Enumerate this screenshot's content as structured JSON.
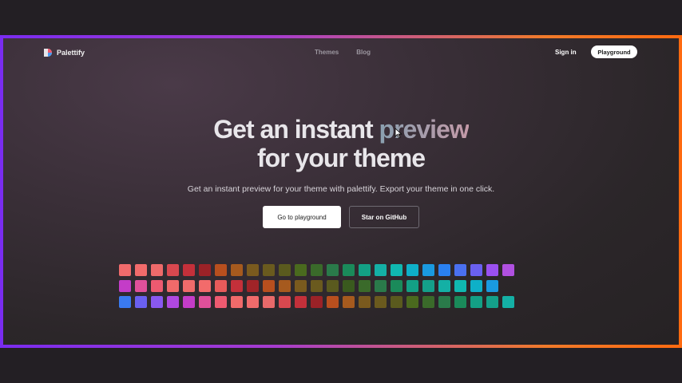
{
  "nav": {
    "brand": "Palettify",
    "links": [
      "Themes",
      "Blog"
    ],
    "sign_in": "Sign in",
    "playground": "Playground"
  },
  "hero": {
    "title_line1_start": "Get an instant ",
    "title_line1_accent": "preview",
    "title_line2": "for your theme",
    "subtitle": "Get an instant preview for your theme with palettify. Export your theme in one click.",
    "primary_button": "Go to playground",
    "secondary_button": "Star on GitHub"
  },
  "icons": [
    "palettify-logo-icon",
    "mouse-cursor-icon"
  ],
  "colors": {
    "frame_gradient_start": "#7a2cf0",
    "frame_gradient_end": "#ff6a10",
    "accent_text_start": "#8aa0b0",
    "accent_text_end": "#c49aa8"
  },
  "swatches": [
    [
      "#f06b6b",
      "#f26b6b",
      "#ee6a6a",
      "#d9484f",
      "#c4303a",
      "#9b2227",
      "#b84f1e",
      "#a65a1e",
      "#7a5a1e",
      "#6a5a1e",
      "#5a5a1e",
      "#4a6a1e",
      "#3a6a2a",
      "#2a7a4a",
      "#1a8a5a",
      "#13a085",
      "#14b0a5",
      "#10b8b0",
      "#0eb0c8",
      "#1a9ae0",
      "#2a80f0",
      "#4a70f0",
      "#6a60f0",
      "#9a50f0",
      "#b050e0"
    ],
    [
      "#c43cc8",
      "#e0509a",
      "#ee5a70",
      "#f06a6a",
      "#f06b6b",
      "#f26b6b",
      "#e85a5a",
      "#c4303a",
      "#a02428",
      "#b84f1e",
      "#a65a1e",
      "#7a5a1e",
      "#6a5a1e",
      "#5a5a1e",
      "#3a5a1e",
      "#3a6a2a",
      "#2a7a4a",
      "#1a8a5a",
      "#13a085",
      "#14a08a",
      "#14b0a5",
      "#10b8b0",
      "#0eb0c8",
      "#1a9ae0"
    ],
    [
      "#3a7af0",
      "#6a60f0",
      "#8a58f0",
      "#b048e0",
      "#c43cc8",
      "#e0509a",
      "#ee5a70",
      "#f06a6a",
      "#f06b6b",
      "#e86a6a",
      "#d9484f",
      "#c4303a",
      "#9b2227",
      "#b84f1e",
      "#a65a1e",
      "#7a5a1e",
      "#6a5a1e",
      "#5a5a1e",
      "#4a6a1e",
      "#3a6a2a",
      "#2a7a4a",
      "#1a8a5a",
      "#13a085",
      "#14a08a",
      "#14b0a5"
    ]
  ]
}
